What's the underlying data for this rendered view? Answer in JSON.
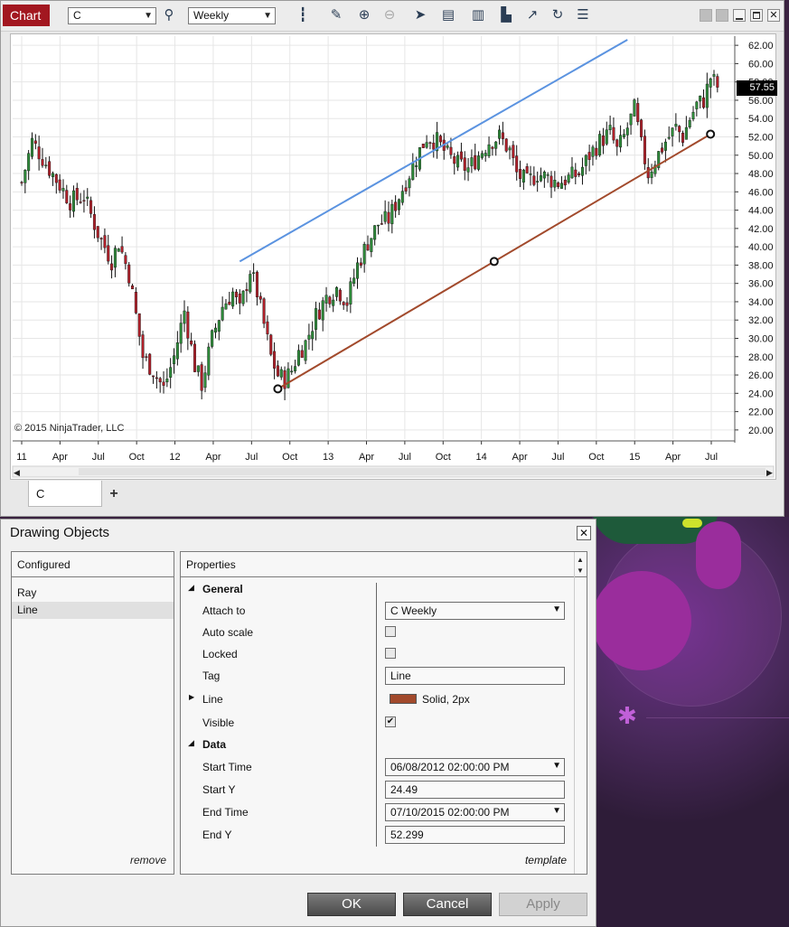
{
  "chart_window": {
    "title": "Chart",
    "instrument": "C",
    "period": "Weekly",
    "copyright": "© 2015 NinjaTrader, LLC",
    "last_price": "57.55",
    "tab_label": "C",
    "add_tab": "+"
  },
  "toolbar_icons": [
    "bar-type-icon",
    "draw-tool-icon",
    "zoom-in-icon",
    "zoom-out-icon",
    "pointer-icon",
    "data-box-icon",
    "indicators-icon",
    "strategies-icon",
    "drawing-objects-icon",
    "reload-icon",
    "properties-icon"
  ],
  "chart_data": {
    "type": "candlestick",
    "x_tick_labels": [
      "11",
      "Apr",
      "Jul",
      "Oct",
      "12",
      "Apr",
      "Jul",
      "Oct",
      "13",
      "Apr",
      "Jul",
      "Oct",
      "14",
      "Apr",
      "Jul",
      "Oct",
      "15",
      "Apr",
      "Jul"
    ],
    "y_tick_labels": [
      "62.00",
      "60.00",
      "58.00",
      "56.00",
      "54.00",
      "52.00",
      "50.00",
      "48.00",
      "46.00",
      "44.00",
      "42.00",
      "40.00",
      "38.00",
      "36.00",
      "34.00",
      "32.00",
      "30.00",
      "28.00",
      "26.00",
      "24.00",
      "22.00",
      "20.00"
    ],
    "ylim": [
      19,
      63
    ],
    "close_path": [
      [
        0,
        47
      ],
      [
        3,
        51.5
      ],
      [
        8,
        48.5
      ],
      [
        14,
        45
      ],
      [
        18,
        45.5
      ],
      [
        22,
        41.5
      ],
      [
        26,
        38.5
      ],
      [
        28,
        40.5
      ],
      [
        31,
        37
      ],
      [
        35,
        28
      ],
      [
        38,
        26.5
      ],
      [
        41,
        24.5
      ],
      [
        44,
        28
      ],
      [
        47,
        33
      ],
      [
        50,
        27
      ],
      [
        52,
        25
      ],
      [
        55,
        30
      ],
      [
        58,
        33.5
      ],
      [
        61,
        35
      ],
      [
        63,
        33
      ],
      [
        66,
        37.5
      ],
      [
        68,
        35
      ],
      [
        70,
        31.5
      ],
      [
        72,
        28
      ],
      [
        74,
        26
      ],
      [
        76,
        25.5
      ],
      [
        78,
        26.5
      ],
      [
        80,
        28.5
      ],
      [
        82,
        29.5
      ],
      [
        85,
        32.5
      ],
      [
        88,
        34.5
      ],
      [
        91,
        35.5
      ],
      [
        94,
        34
      ],
      [
        97,
        38
      ],
      [
        100,
        40.5
      ],
      [
        103,
        42.5
      ],
      [
        106,
        43
      ],
      [
        109,
        45.5
      ],
      [
        112,
        48
      ],
      [
        115,
        50.5
      ],
      [
        117,
        52
      ],
      [
        120,
        51.5
      ],
      [
        123,
        50
      ],
      [
        126,
        49
      ],
      [
        129,
        48.5
      ],
      [
        132,
        50
      ],
      [
        135,
        51.5
      ],
      [
        138,
        52
      ],
      [
        141,
        50.5
      ],
      [
        143,
        48
      ],
      [
        146,
        47
      ],
      [
        149,
        48
      ],
      [
        152,
        47.5
      ],
      [
        155,
        47
      ],
      [
        158,
        47.5
      ],
      [
        161,
        48
      ],
      [
        164,
        50
      ],
      [
        167,
        51.5
      ],
      [
        170,
        52.5
      ],
      [
        172,
        50.5
      ],
      [
        174,
        52
      ],
      [
        177,
        55
      ],
      [
        179,
        51
      ],
      [
        181,
        48
      ],
      [
        183,
        49.5
      ],
      [
        186,
        51.5
      ],
      [
        189,
        53
      ],
      [
        191,
        52
      ],
      [
        193,
        54
      ],
      [
        195,
        55.5
      ],
      [
        197,
        56
      ],
      [
        199,
        58.5
      ],
      [
        201,
        57.5
      ]
    ],
    "drawn_ray": {
      "x1": 63,
      "y1": 38.4,
      "x2": 175,
      "y2": 62.6,
      "color": "#5b93e0"
    },
    "drawn_line": {
      "x1": 74,
      "y1": 24.49,
      "x2": 199,
      "y2": 52.299,
      "color": "#a24a2c"
    }
  },
  "dialog": {
    "title": "Drawing Objects",
    "close": "✕",
    "configured_header": "Configured",
    "configured_items": [
      "Ray",
      "Line"
    ],
    "remove": "remove",
    "properties_header": "Properties",
    "template": "template",
    "general": "General",
    "attach_to_label": "Attach to",
    "attach_to_value": "C Weekly",
    "auto_scale_label": "Auto scale",
    "locked_label": "Locked",
    "tag_label": "Tag",
    "tag_value": "Line",
    "line_label": "Line",
    "line_value": "Solid, 2px",
    "line_color": "#a24a2c",
    "visible_label": "Visible",
    "data": "Data",
    "start_time_label": "Start Time",
    "start_time_value": "06/08/2012 02:00:00 PM",
    "start_y_label": "Start Y",
    "start_y_value": "24.49",
    "end_time_label": "End Time",
    "end_time_value": "07/10/2015 02:00:00 PM",
    "end_y_label": "End Y",
    "end_y_value": "52.299",
    "ok": "OK",
    "cancel": "Cancel",
    "apply": "Apply"
  }
}
